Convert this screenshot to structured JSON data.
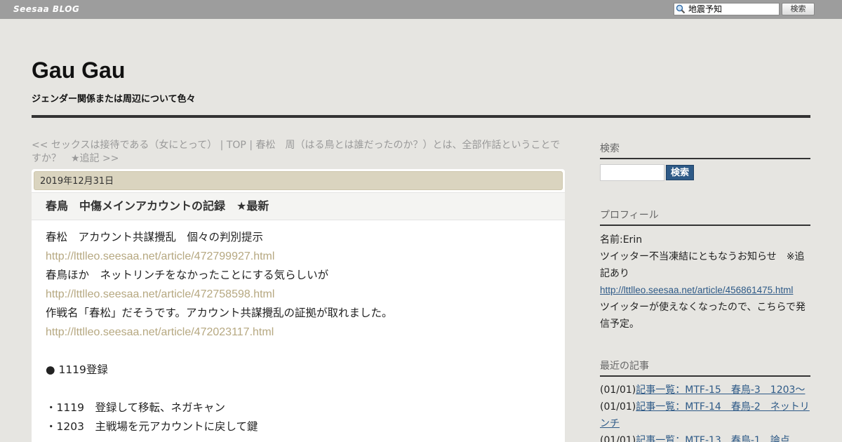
{
  "topbar": {
    "logo": "Seesaa BLOG",
    "search_value": "地震予知",
    "search_button": "検索"
  },
  "header": {
    "title": "Gau Gau",
    "description": "ジェンダー関係または周辺について色々"
  },
  "nav": {
    "prev": "<< セックスは接待である（女にとって）",
    "sep1": " | ",
    "top": "TOP",
    "sep2": " | ",
    "next": "春松　周（はる鳥とは誰だったのか？）とは、全部作話ということですか？　★追記 >>"
  },
  "article": {
    "date": "2019年12月31日",
    "title": "春鳥　中傷メインアカウントの記録　★最新",
    "lines": [
      {
        "text": "春松　アカウント共謀攪乱　個々の判別提示",
        "type": "text"
      },
      {
        "text": "http://lttlleo.seesaa.net/article/472799927.html",
        "type": "link"
      },
      {
        "text": "春鳥ほか　ネットリンチをなかったことにする気らしいが",
        "type": "text"
      },
      {
        "text": "http://lttlleo.seesaa.net/article/472758598.html",
        "type": "link"
      },
      {
        "text": "作戦名「春松」だそうです。アカウント共謀攪乱の証拠が取れました。",
        "type": "text"
      },
      {
        "text": "http://lttlleo.seesaa.net/article/472023117.html",
        "type": "link"
      },
      {
        "text": "",
        "type": "text"
      },
      {
        "text": "● 1119登録",
        "type": "text"
      },
      {
        "text": "",
        "type": "text"
      },
      {
        "text": "・1119　登録して移転、ネガキャン",
        "type": "text"
      },
      {
        "text": "・1203　主戦場を元アカウントに戻して鍵",
        "type": "text"
      }
    ]
  },
  "sidebar": {
    "search_heading": "検索",
    "search_button": "検索",
    "profile_heading": "プロフィール",
    "profile_name": "名前:Erin",
    "profile_notice": "ツイッター不当凍結にともなうお知らせ　※追記あり",
    "profile_link": "http://lttlleo.seesaa.net/article/456861475.html",
    "profile_note": "ツイッターが使えなくなったので、こちらで発信予定。",
    "recent_heading": "最近の記事",
    "recent_items": [
      {
        "date": "(01/01)",
        "title": "記事一覧：MTF-15　春鳥-3　1203～"
      },
      {
        "date": "(01/01)",
        "title": "記事一覧：MTF-14　春鳥-2　ネットリンチ"
      },
      {
        "date": "(01/01)",
        "title": "記事一覧：MTF-13　春鳥-1　論点"
      }
    ]
  },
  "colors": {
    "topbar": "#9d9d9d",
    "background": "#e6e5e1",
    "date_box": "#dad4bf",
    "article_link": "#b6a881",
    "sidebar_link": "#2e5a87",
    "search_button": "#2e5a87"
  }
}
